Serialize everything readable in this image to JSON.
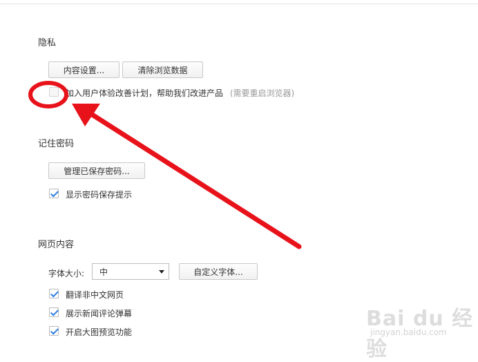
{
  "privacy": {
    "heading": "隐私",
    "content_settings_button": "内容设置...",
    "clear_data_button": "清除浏览数据",
    "join_program_label": "加入用户体验改善计划，帮助我们改进产品",
    "restart_note": "(需要重启浏览器)",
    "join_program_checked": false
  },
  "passwords": {
    "heading": "记住密码",
    "manage_button": "管理已保存密码...",
    "show_prompt_label": "显示密码保存提示",
    "show_prompt_checked": true
  },
  "web_content": {
    "heading": "网页内容",
    "font_size_label": "字体大小:",
    "font_size_value": "中",
    "custom_fonts_button": "自定义字体...",
    "options": [
      {
        "label": "翻译非中文网页",
        "checked": true
      },
      {
        "label": "展示新闻评论弹幕",
        "checked": true
      },
      {
        "label": "开启大图预览功能",
        "checked": true
      }
    ]
  },
  "annotation": {
    "color": "#e8121a",
    "shapes": [
      "circle",
      "arrow"
    ]
  },
  "watermark": {
    "main": "Bai du 经验",
    "sub": "jingyan.baidu.com"
  }
}
